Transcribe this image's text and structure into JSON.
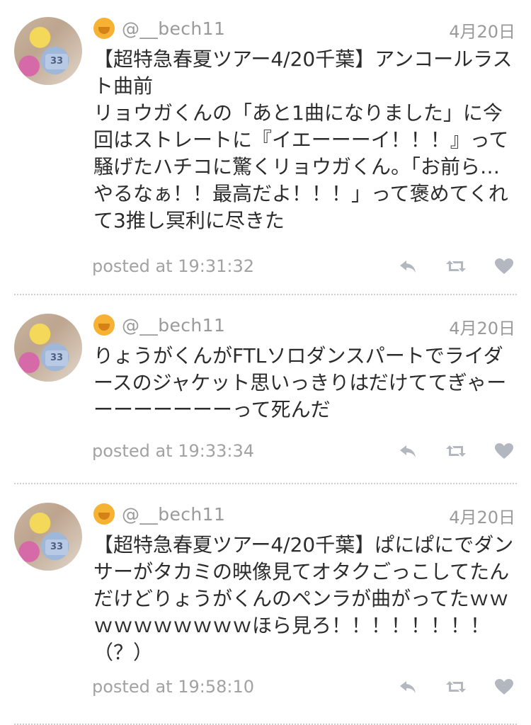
{
  "tweets": [
    {
      "handle": "@__bech11",
      "date": "4月20日",
      "text": "【超特急春夏ツアー4/20千葉】アンコールラスト曲前\nリョウガくんの「あと1曲になりました」に今回はストレートに『イエーーーイ！！！』って騒げたハチコに驚くリョウガくん。「お前ら…やるなぁ！！最高だよ！！！」って褒めてくれて3推し冥利に尽きた",
      "posted": "posted at 19:31:32",
      "avatar_badge": "33"
    },
    {
      "handle": "@__bech11",
      "date": "4月20日",
      "text": "りょうがくんがFTLソロダンスパートでライダースのジャケット思いっきりはだけててぎゃーーーーーーーーって死んだ",
      "posted": "posted at 19:33:34",
      "avatar_badge": "33"
    },
    {
      "handle": "@__bech11",
      "date": "4月20日",
      "text": "【超特急春夏ツアー4/20千葉】ぱにぱにでダンサーがタカミの映像見てオタクごっこしてたんだけどりょうがくんのペンラが曲がってたｗｗｗｗｗｗｗｗｗｗほら見ろ！！！！！！！！（？）",
      "posted": "posted at 19:58:10",
      "avatar_badge": "33"
    }
  ],
  "icons": {
    "reply": "reply-icon",
    "retweet": "retweet-icon",
    "like": "heart-icon",
    "emoji": "hand-over-mouth-emoji-icon"
  },
  "colors": {
    "meta_text": "#9a9a9a",
    "body_text": "#2c2c2c",
    "icon_gray": "#b3b7bf",
    "divider": "#cfcfcf"
  }
}
